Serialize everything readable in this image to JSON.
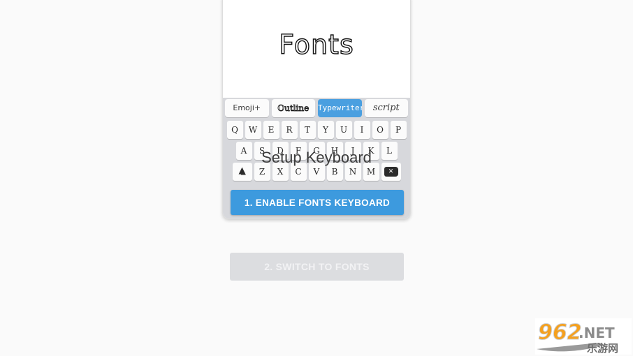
{
  "page": {
    "background_color": "#fafafa"
  },
  "phone_card": {
    "title": "Fonts",
    "overlay_heading": "Setup Keyboard",
    "enable_button_label": "1. ENABLE FONTS KEYBOARD",
    "enable_button_color": "#3d9ade",
    "keyboard_background": "#d7d8dc",
    "key_background": "#fbfbfb",
    "font_tabs": [
      {
        "label": "Emoji+",
        "style": "emoji",
        "selected": false
      },
      {
        "label": "Outline",
        "style": "outline",
        "selected": false
      },
      {
        "label": "Typewriter",
        "style": "typewriter",
        "selected": true
      },
      {
        "label": "script",
        "style": "script",
        "selected": false
      }
    ],
    "keyboard_rows": [
      {
        "keys": [
          "Q",
          "W",
          "E",
          "R",
          "T",
          "Y",
          "U",
          "I",
          "O",
          "P"
        ]
      },
      {
        "keys": [
          "A",
          "S",
          "D",
          "F",
          "G",
          "H",
          "J",
          "K",
          "L"
        ]
      },
      {
        "keys": [
          "⇧",
          "Z",
          "X",
          "C",
          "V",
          "B",
          "N",
          "M",
          "✕"
        ]
      }
    ],
    "shift_key_icon": "shift-icon",
    "backspace_key_icon": "backspace-icon",
    "backspace_glyph": "✕"
  },
  "switch_button": {
    "label": "2. SWITCH TO FONTS",
    "background_color": "#dcdde0",
    "text_color": "#f2f2f4",
    "disabled": true
  },
  "watermark": {
    "digits": "962",
    "suffix": ".NET",
    "chinese": "乐游网",
    "digits_color": "#f5a01e",
    "suffix_color": "#8c8c8c"
  }
}
